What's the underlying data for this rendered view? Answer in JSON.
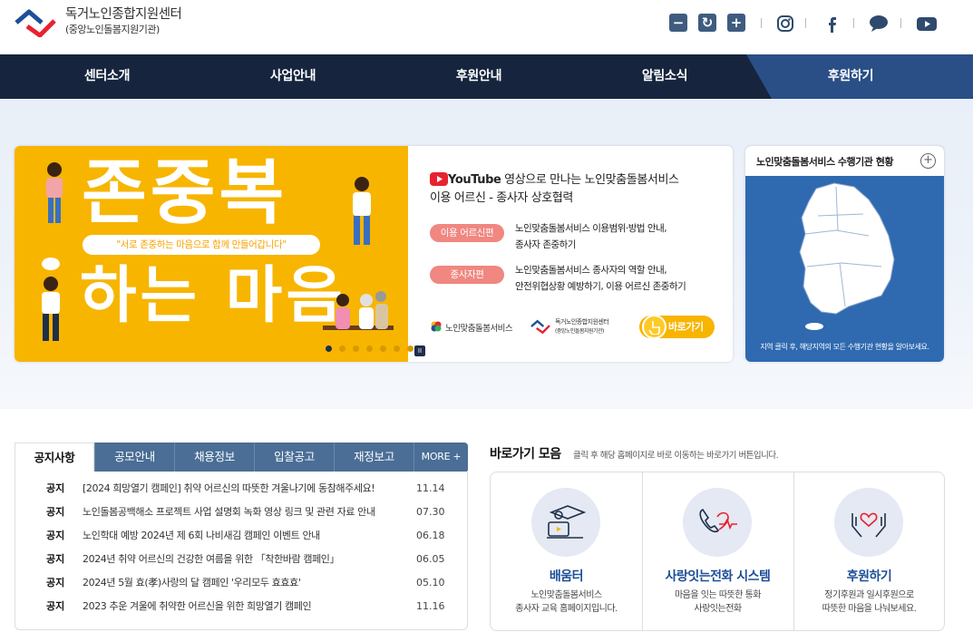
{
  "header": {
    "org_name": "독거노인종합지원센터",
    "org_sub": "(중앙노인돌봄지원기관)",
    "tools": {
      "zoom_out": "−",
      "reset": "↻",
      "zoom_in": "+"
    },
    "social_icons": [
      "instagram-icon",
      "facebook-icon",
      "chat-icon",
      "youtube-icon"
    ]
  },
  "nav": {
    "items": [
      "센터소개",
      "사업안내",
      "후원안내",
      "알림소식"
    ],
    "donate": "후원하기",
    "bg": "#16253d",
    "donate_bg": "#2a4f86"
  },
  "banner": {
    "headline_top": "존중복",
    "headline_bottom": "하는 마음",
    "slogan": "\"서로 존중하는 마음으로 함께 만들어갑니다\"",
    "youtube_word": "YouTube",
    "title_line1": " 영상으로 만나는 노인맞춤돌봄서비스",
    "title_line2": "이용 어르신 - 종사자 상호협력",
    "pill1": "이용 어르신편",
    "pill1_text1": "노인맞춤돌봄서비스 이용범위·방법 안내,",
    "pill1_text2": "종사자 존중하기",
    "pill2": "종사자편",
    "pill2_text1": "노인맞춤돌봄서비스 종사자의 역할 안내,",
    "pill2_text2": "안전위협상황 예방하기, 이용 어르신 존중하기",
    "logo1": "노인맞춤돌봄서비스",
    "logo2_name": "독거노인종합지원센터",
    "logo2_sub": "(중앙노인돌봄지원기관)",
    "go_button": "바로가기",
    "pause": "II",
    "accent": "#f7b500"
  },
  "map": {
    "title": "노인맞춤돌봄서비스 수행기관 현황",
    "plus": "+",
    "footer": "지역 클릭 후, 해당지역의 모든 수행기관 현황을 알아보세요."
  },
  "notice": {
    "tabs": [
      "공지사항",
      "공모안내",
      "채용정보",
      "입찰공고",
      "재정보고",
      "MORE +"
    ],
    "rows": [
      {
        "tag": "공지",
        "title": "[2024 희망열기 캠페인] 취약 어르신의 따뜻한 겨울나기에 동참해주세요!",
        "date": "11.14"
      },
      {
        "tag": "공지",
        "title": "노인돌봄공백해소 프로젝트 사업 설명회 녹화 영상 링크 및 관련 자료 안내",
        "date": "07.30"
      },
      {
        "tag": "공지",
        "title": "노인학대 예방 2024년 제 6회 나비새김 캠페인 이벤트 안내",
        "date": "06.18"
      },
      {
        "tag": "공지",
        "title": "2024년 취약 어르신의 건강한 여름을 위한 「착한바람 캠페인」",
        "date": "06.05"
      },
      {
        "tag": "공지",
        "title": "2024년 5월 효(孝)사랑의 달 캠페인 '우리모두 효효효'",
        "date": "05.10"
      },
      {
        "tag": "공지",
        "title": "2023 추운 겨울에 취약한 어르신을 위한 희망열기 캠페인",
        "date": "11.16"
      }
    ]
  },
  "quick": {
    "title": "바로가기 모음",
    "desc": "클릭 후 해당 홈페이지로 바로 이동하는 바로가기 버튼입니다.",
    "items": [
      {
        "name": "배움터",
        "sub1": "노인맞춤돌봄서비스",
        "sub2": "종사자 교육 홈페이지입니다.",
        "icon": "education-icon"
      },
      {
        "name": "사랑잇는전화 시스템",
        "sub1": "마음을 잇는 따뜻한 통화",
        "sub2": "사랑잇는전화",
        "icon": "phone-heart-icon"
      },
      {
        "name": "후원하기",
        "sub1": "정기후원과 일시후원으로",
        "sub2": "따뜻한 마음을 나눠보세요.",
        "icon": "hands-heart-icon"
      }
    ]
  }
}
